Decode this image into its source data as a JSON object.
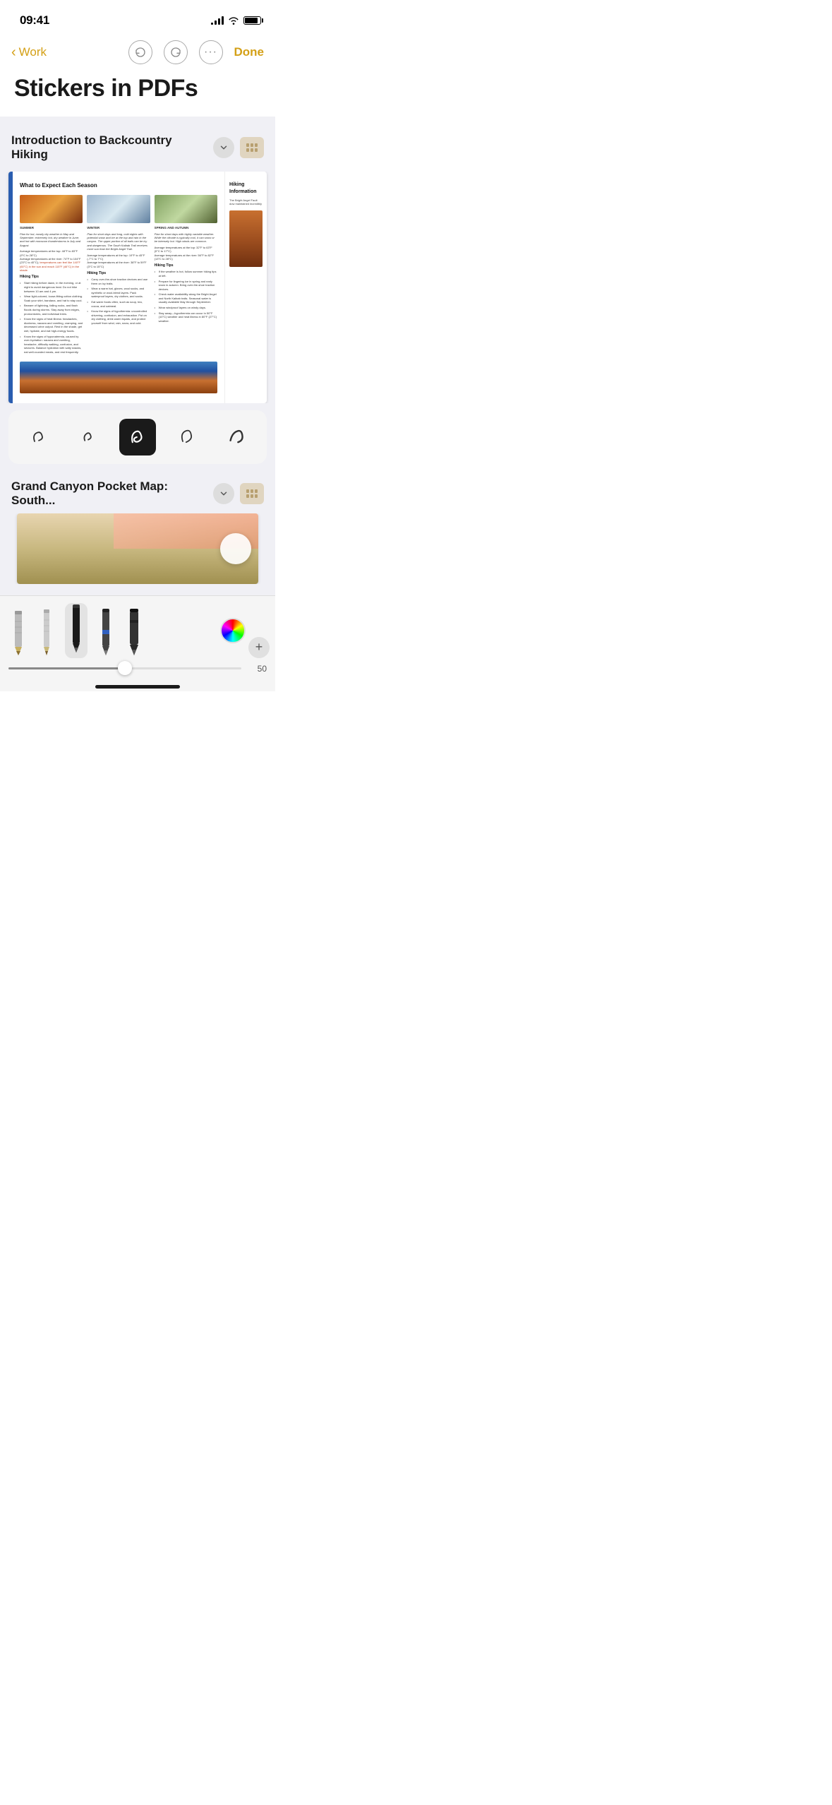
{
  "statusBar": {
    "time": "09:41",
    "signalBars": [
      3,
      6,
      9,
      12
    ],
    "batteryLevel": 85
  },
  "navBar": {
    "backLabel": "Work",
    "doneLabel": "Done",
    "undoLabel": "Undo",
    "redoLabel": "Redo",
    "moreLabel": "More"
  },
  "pageTitle": "Stickers in PDFs",
  "sections": [
    {
      "id": "section1",
      "title": "Introduction to Backcountry Hiking",
      "collapsed": false
    },
    {
      "id": "section2",
      "title": "Grand Canyon Pocket Map: South...",
      "collapsed": false
    }
  ],
  "pdfContent": {
    "heading": "What to Expect Each Season",
    "seasons": [
      {
        "label": "SUMMER",
        "text": "Plan for hot, mostly dry weather in May and September; extremely hot, dry weather in June; and hot with monsoon thunderstorms in July and August.",
        "subtext": "Average temperatures at the top: 48°F to 83°F (9°C to 28°C)\nAverage temperatures at the river: 74°F to 104°F (23°C to 40°C); temperatures can feel like 140°F (60°C) in the sun and reach 115°F (46°C) in the shade.",
        "highlight": "temperatures can feel like 140°F (60°C) in the sun and reach 115°F (46°C) in the shade."
      },
      {
        "label": "WINTER",
        "text": "Plan for short days and long, cold nights with potential snow and ice at the top and rain in the canyon. The upper portion of all trails can be icy and dangerous. The South Kaibab Trail receives more sun than the Bright Angel Trail.",
        "subtext": "Average temperatures at the top: 19°F to 45°F (-7°C to 7°C)\nAverage temperatures at the river: 38°F to 59°F (3°C to 15°C)"
      },
      {
        "label": "SPRING AND AUTUMN",
        "text": "Plan for short days with highly variable weather. While the climate is typically cool, it can snow or be intensely hot. High winds are common.",
        "subtext": "Average temperatures at the top: 32°F to 63°F (0°C to 17°C)\nAverage temperatures at the river: 56°F to 82°F (13°C to 28°C)"
      }
    ],
    "hikingTips": {
      "summer": [
        "Start hiking before dawn, in the evening, or at night to avoid dangerous heat. Do not hike between 10 am and 4 pm.",
        "Wear light-colored, loose-fitting cotton clothing. Soak your shirt, bandana, and hat to stay cool.",
        "Beware of lightning, falling rocks, and flash floods during storms. Stay away from edges, promontories, and individual trees.",
        "Know the signs of heat illness: headaches, dizziness, nausea and vomiting, cramping, and decreased urine output. Rest in the shade, get wet, hydrate, and eat high-energy foods.",
        "Know the signs of hyponatremia, caused by over-hydration: nausea and vomiting, headache, difficulty walking, confusion, and seizures. Balance hydration with salty snacks, eat well-rounded meals, and rest frequently."
      ],
      "winter": [
        "Carry over-the-shoe traction devices and use them on icy trails.",
        "Wear a warm hat, gloves, wool socks, and synthetic or wool-blend layers. Pack waterproof layers, dry clothes, and socks.",
        "Eat warm foods often, such as soup, tea, cocoa, and oatmeal.",
        "Know the signs of hypothermia: uncontrolled shivering, confusion, and exhaustion. Put on dry clothing, drink warm liquids, and protect yourself from wind, rain, snow, and cold."
      ],
      "springAutumn": [
        "If the weather is hot, follow summer hiking tips at left.",
        "Prepare for lingering ice in spring and early snow in autumn. Bring over-the-shoe traction devices.",
        "Check water availability along the Bright Angel and North Kaibab trails. Seasonal water is usually available May through September.",
        "Wear windproof layers on windy days.",
        "Stay away—hypothermia can occur in 50°F (10°C) weather and heat illness in 80°F (27°C) weather."
      ]
    }
  },
  "rightStrip": {
    "title": "Hiking Information",
    "text": "The Bright Angel Fault dow maintained incredibly"
  },
  "stickers": [
    {
      "id": 1,
      "label": "sticker-1",
      "selected": false
    },
    {
      "id": 2,
      "label": "sticker-2",
      "selected": false
    },
    {
      "id": 3,
      "label": "sticker-3",
      "selected": true
    },
    {
      "id": 4,
      "label": "sticker-4",
      "selected": false
    },
    {
      "id": 5,
      "label": "sticker-5",
      "selected": false
    }
  ],
  "tools": [
    {
      "id": "pencil-1",
      "type": "pencil",
      "color": "#9a9a9a"
    },
    {
      "id": "pencil-2",
      "type": "pencil",
      "color": "#8a8a8a"
    },
    {
      "id": "pen-1",
      "type": "pen",
      "color": "#2a2a2a",
      "selected": true
    },
    {
      "id": "pen-2",
      "type": "pen",
      "color": "#555"
    },
    {
      "id": "marker-1",
      "type": "marker",
      "color": "#333"
    }
  ],
  "toolbar": {
    "colorPickerLabel": "Color Picker",
    "addLabel": "Add",
    "thicknessValue": "50"
  }
}
